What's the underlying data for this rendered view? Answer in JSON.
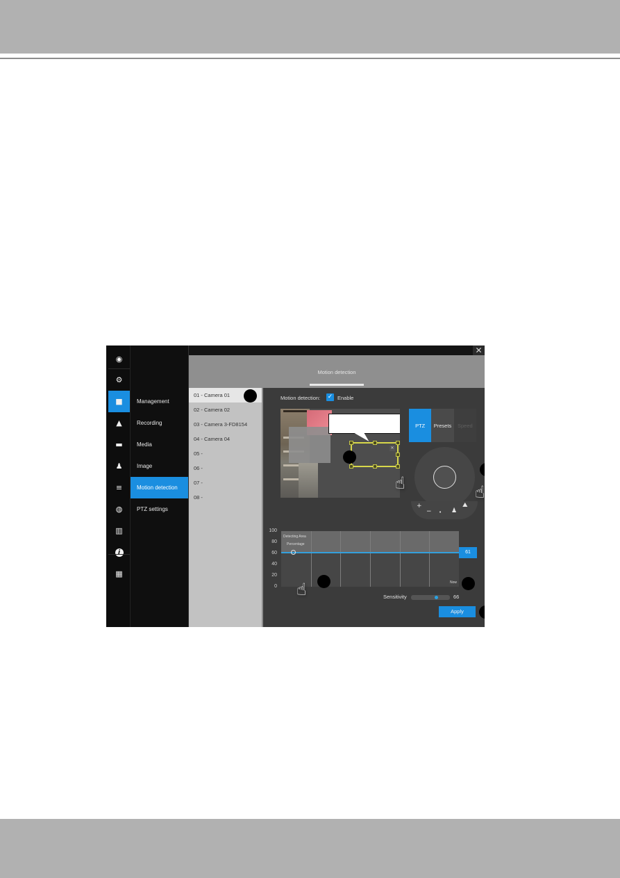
{
  "window": {
    "close_glyph": "✕",
    "active_tab": "Motion detection"
  },
  "icon_rail": [
    {
      "icon": "live-view-icon",
      "glyph": "◉",
      "active": false
    },
    {
      "icon": "gear-icon",
      "glyph": "⚙",
      "active": false
    },
    {
      "icon": "camera-icon",
      "glyph": "■",
      "active": true
    },
    {
      "icon": "bell-icon",
      "glyph": "▲",
      "active": false
    },
    {
      "icon": "computer-icon",
      "glyph": "▬",
      "active": false
    },
    {
      "icon": "user-icon",
      "glyph": "♟",
      "active": false
    },
    {
      "icon": "database-icon",
      "glyph": "≡",
      "active": false
    },
    {
      "icon": "network-icon",
      "glyph": "◍",
      "active": false
    },
    {
      "icon": "book-icon",
      "glyph": "▥",
      "active": false
    },
    {
      "icon": "info-icon",
      "glyph": "i",
      "active": false
    },
    {
      "icon": "keyboard-icon",
      "glyph": "▦",
      "active": false
    }
  ],
  "menu": [
    {
      "label": "Management",
      "active": false
    },
    {
      "label": "Recording",
      "active": false
    },
    {
      "label": "Media",
      "active": false
    },
    {
      "label": "Image",
      "active": false
    },
    {
      "label": "Motion detection",
      "active": true
    },
    {
      "label": "PTZ settings",
      "active": false
    }
  ],
  "cameras": [
    {
      "label": "01 - Camera 01",
      "active": true
    },
    {
      "label": "02 - Camera 02",
      "active": false
    },
    {
      "label": "03 - Camera 3-FD8154",
      "active": false
    },
    {
      "label": "04 - Camera 04",
      "active": false
    },
    {
      "label": "05 -",
      "active": false
    },
    {
      "label": "06 -",
      "active": false
    },
    {
      "label": "07 -",
      "active": false
    },
    {
      "label": "08 -",
      "active": false
    }
  ],
  "motion": {
    "label": "Motion detection:",
    "enabled": true,
    "check_glyph": "✓",
    "enable_label": "Enable",
    "window_close_glyph": "✕"
  },
  "ptz": {
    "tabs": [
      {
        "label": "PTZ",
        "state": "active"
      },
      {
        "label": "Presets",
        "state": "normal"
      },
      {
        "label": "Speed",
        "state": "disabled"
      }
    ],
    "controls": {
      "zoom_in": "+",
      "zoom_out": "−",
      "stop": "•",
      "person": "♟",
      "home": "⛰"
    }
  },
  "chart_data": {
    "type": "line",
    "title": "Detecting Area",
    "subtitle": "Percentage",
    "ylim": [
      0,
      100
    ],
    "yticks": [
      "100",
      "80",
      "60",
      "40",
      "20",
      "0"
    ],
    "x_end_label": "Now",
    "columns": 6,
    "threshold": 61,
    "threshold_label": "61",
    "series": [
      {
        "name": "Detecting Area Percentage",
        "values": []
      }
    ]
  },
  "sensitivity": {
    "label": "Sensitivity",
    "value": 66,
    "value_label": "66"
  },
  "apply_label": "Apply"
}
